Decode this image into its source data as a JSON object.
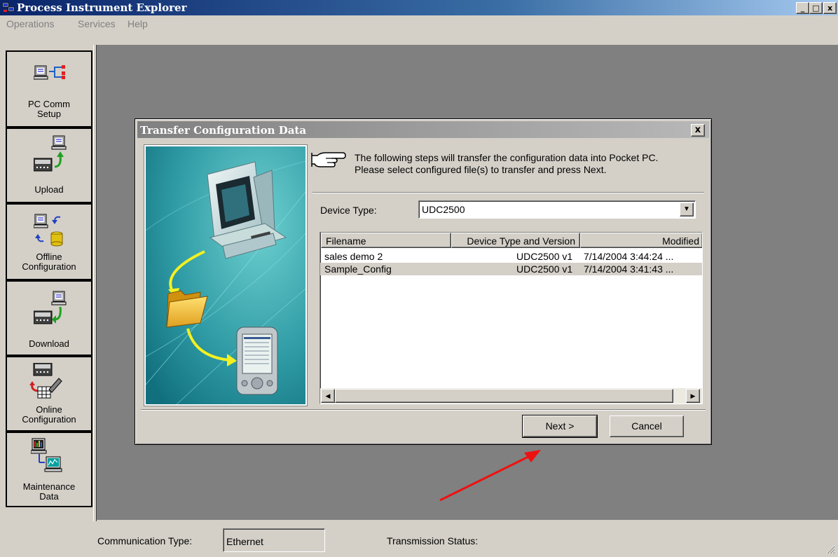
{
  "window": {
    "title": "Process Instrument Explorer",
    "min_glyph": "_",
    "max_glyph": "□",
    "close_glyph": "x"
  },
  "menu": {
    "items": [
      "Operations",
      "Services",
      "Help"
    ]
  },
  "sidebar": {
    "items": [
      {
        "label_line1": "PC Comm",
        "label_line2": "Setup",
        "icon": "pc-network-icon"
      },
      {
        "label_line1": "Upload",
        "label_line2": "",
        "icon": "upload-icon"
      },
      {
        "label_line1": "Offline",
        "label_line2": "Configuration",
        "icon": "offline-config-icon"
      },
      {
        "label_line1": "Download",
        "label_line2": "",
        "icon": "download-icon"
      },
      {
        "label_line1": "Online",
        "label_line2": "Configuration",
        "icon": "online-config-icon"
      },
      {
        "label_line1": "Maintenance",
        "label_line2": "Data",
        "icon": "maintenance-icon"
      }
    ]
  },
  "dialog": {
    "title": "Transfer Configuration Data",
    "close_glyph": "x",
    "instruction_line1": "The following steps will transfer the configuration data into Pocket PC.",
    "instruction_line2": "Please select configured file(s) to transfer and press Next.",
    "device_type_label": "Device Type:",
    "device_type_value": "UDC2500",
    "columns": [
      "Filename",
      "Device Type and Version",
      "Modified"
    ],
    "rows": [
      {
        "filename": "sales demo 2",
        "device": "UDC2500  v1",
        "modified": "7/14/2004 3:44:24 ..."
      },
      {
        "filename": "Sample_Config",
        "device": "UDC2500  v1",
        "modified": "7/14/2004 3:41:43 ..."
      }
    ],
    "next_label": "Next >",
    "cancel_label": "Cancel"
  },
  "status": {
    "comm_type_label": "Communication Type:",
    "comm_type_value": "Ethernet",
    "transmission_label": "Transmission Status:"
  },
  "colors": {
    "annotation_arrow": "#ee1111"
  }
}
